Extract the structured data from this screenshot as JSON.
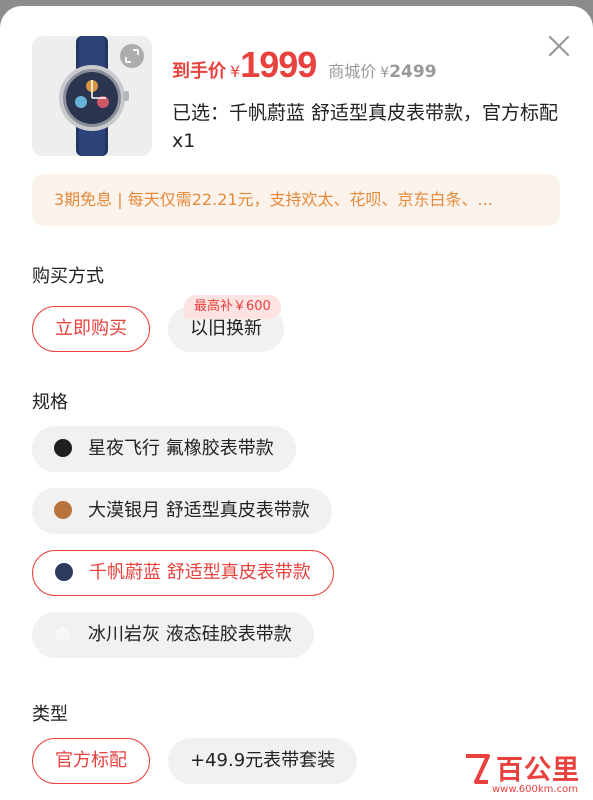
{
  "header": {
    "price_prefix": "到手价",
    "currency": "¥",
    "price": "1999",
    "mall_price_label": "商城价",
    "mall_price": "2499",
    "selected_text": "已选：千帆蔚蓝 舒适型真皮表带款，官方标配 x1"
  },
  "installment_banner": "3期免息 | 每天仅需22.21元，支持欢太、花呗、京东白条、...",
  "purchase": {
    "title": "购买方式",
    "options": [
      {
        "label": "立即购买",
        "selected": true
      },
      {
        "label": "以旧换新",
        "selected": false
      }
    ],
    "subsidy_badge": "最高补￥600"
  },
  "spec": {
    "title": "规格",
    "options": [
      {
        "label": "星夜飞行 氟橡胶表带款",
        "color": "#1f1f1f",
        "selected": false
      },
      {
        "label": "大漠银月 舒适型真皮表带款",
        "color": "#b9743e",
        "selected": false
      },
      {
        "label": "千帆蔚蓝 舒适型真皮表带款",
        "color": "#2d3b5e",
        "selected": true
      },
      {
        "label": "冰川岩灰 液态硅胶表带款",
        "color": "#f4f4f4",
        "selected": false
      }
    ]
  },
  "type": {
    "title": "类型",
    "options": [
      {
        "label": "官方标配",
        "selected": true
      },
      {
        "label": "+49.9元表带套装",
        "selected": false
      }
    ]
  },
  "colors": {
    "accent": "#e8413e",
    "banner_text": "#e58a3c",
    "banner_bg": "#fbf3ec",
    "pill_bg": "#f1f1f1"
  },
  "icons": {
    "close": "close-icon",
    "zoom": "expand-icon"
  },
  "watermark": {
    "text": "百公里",
    "sub": "www.600km.com"
  }
}
